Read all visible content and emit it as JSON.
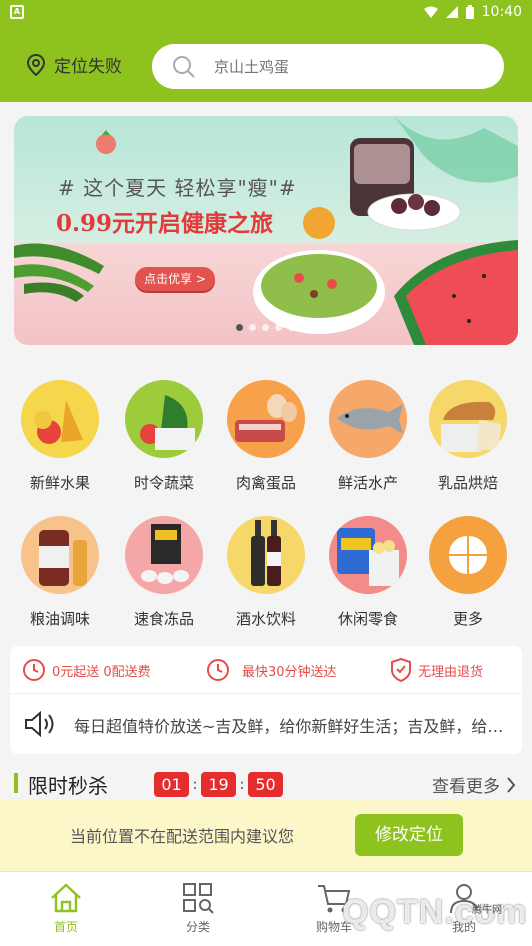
{
  "status_bar": {
    "time": "10:40"
  },
  "header": {
    "location_label": "定位失败",
    "search_placeholder": "京山土鸡蛋"
  },
  "banner": {
    "title": "# 这个夏天 轻松享\"瘦\"#",
    "subtitle": "0.99元开启健康之旅",
    "button_label": "点击优享 >",
    "dot_count": 5,
    "active_dot": 0
  },
  "categories": [
    {
      "label": "新鲜水果",
      "icon": "fruit-icon"
    },
    {
      "label": "时令蔬菜",
      "icon": "vegetable-icon"
    },
    {
      "label": "肉禽蛋品",
      "icon": "meat-egg-icon"
    },
    {
      "label": "鲜活水产",
      "icon": "seafood-icon"
    },
    {
      "label": "乳品烘焙",
      "icon": "dairy-bakery-icon"
    },
    {
      "label": "粮油调味",
      "icon": "grain-oil-icon"
    },
    {
      "label": "速食冻品",
      "icon": "frozen-food-icon"
    },
    {
      "label": "酒水饮料",
      "icon": "drinks-icon"
    },
    {
      "label": "休闲零食",
      "icon": "snacks-icon"
    },
    {
      "label": "更多",
      "icon": "more-icon"
    }
  ],
  "services": [
    {
      "label": "0元起送 0配送费",
      "icon": "clock-icon"
    },
    {
      "label": "最快30分钟送达",
      "icon": "clock-icon"
    },
    {
      "label": "无理由退货",
      "icon": "shield-icon"
    }
  ],
  "notice": {
    "text": "每日超值特价放送~吉及鲜，给你新鲜好生活；吉及鲜，给你新鲜好生活"
  },
  "flash_sale": {
    "title": "限时秒杀",
    "hours": "01",
    "minutes": "19",
    "seconds": "50",
    "more_label": "查看更多"
  },
  "location_warning": {
    "text": "当前位置不在配送范围内建议您",
    "button_label": "修改定位"
  },
  "tabs": [
    {
      "label": "首页",
      "active": true
    },
    {
      "label": "分类",
      "active": false
    },
    {
      "label": "购物车",
      "active": false
    },
    {
      "label": "我的",
      "active": false
    }
  ],
  "watermark": {
    "text": "QQTN.com",
    "small": "腾牛网"
  },
  "colors": {
    "brand": "#8dc21f",
    "accent_red": "#e52d2d",
    "service_red": "#e64c4c"
  }
}
